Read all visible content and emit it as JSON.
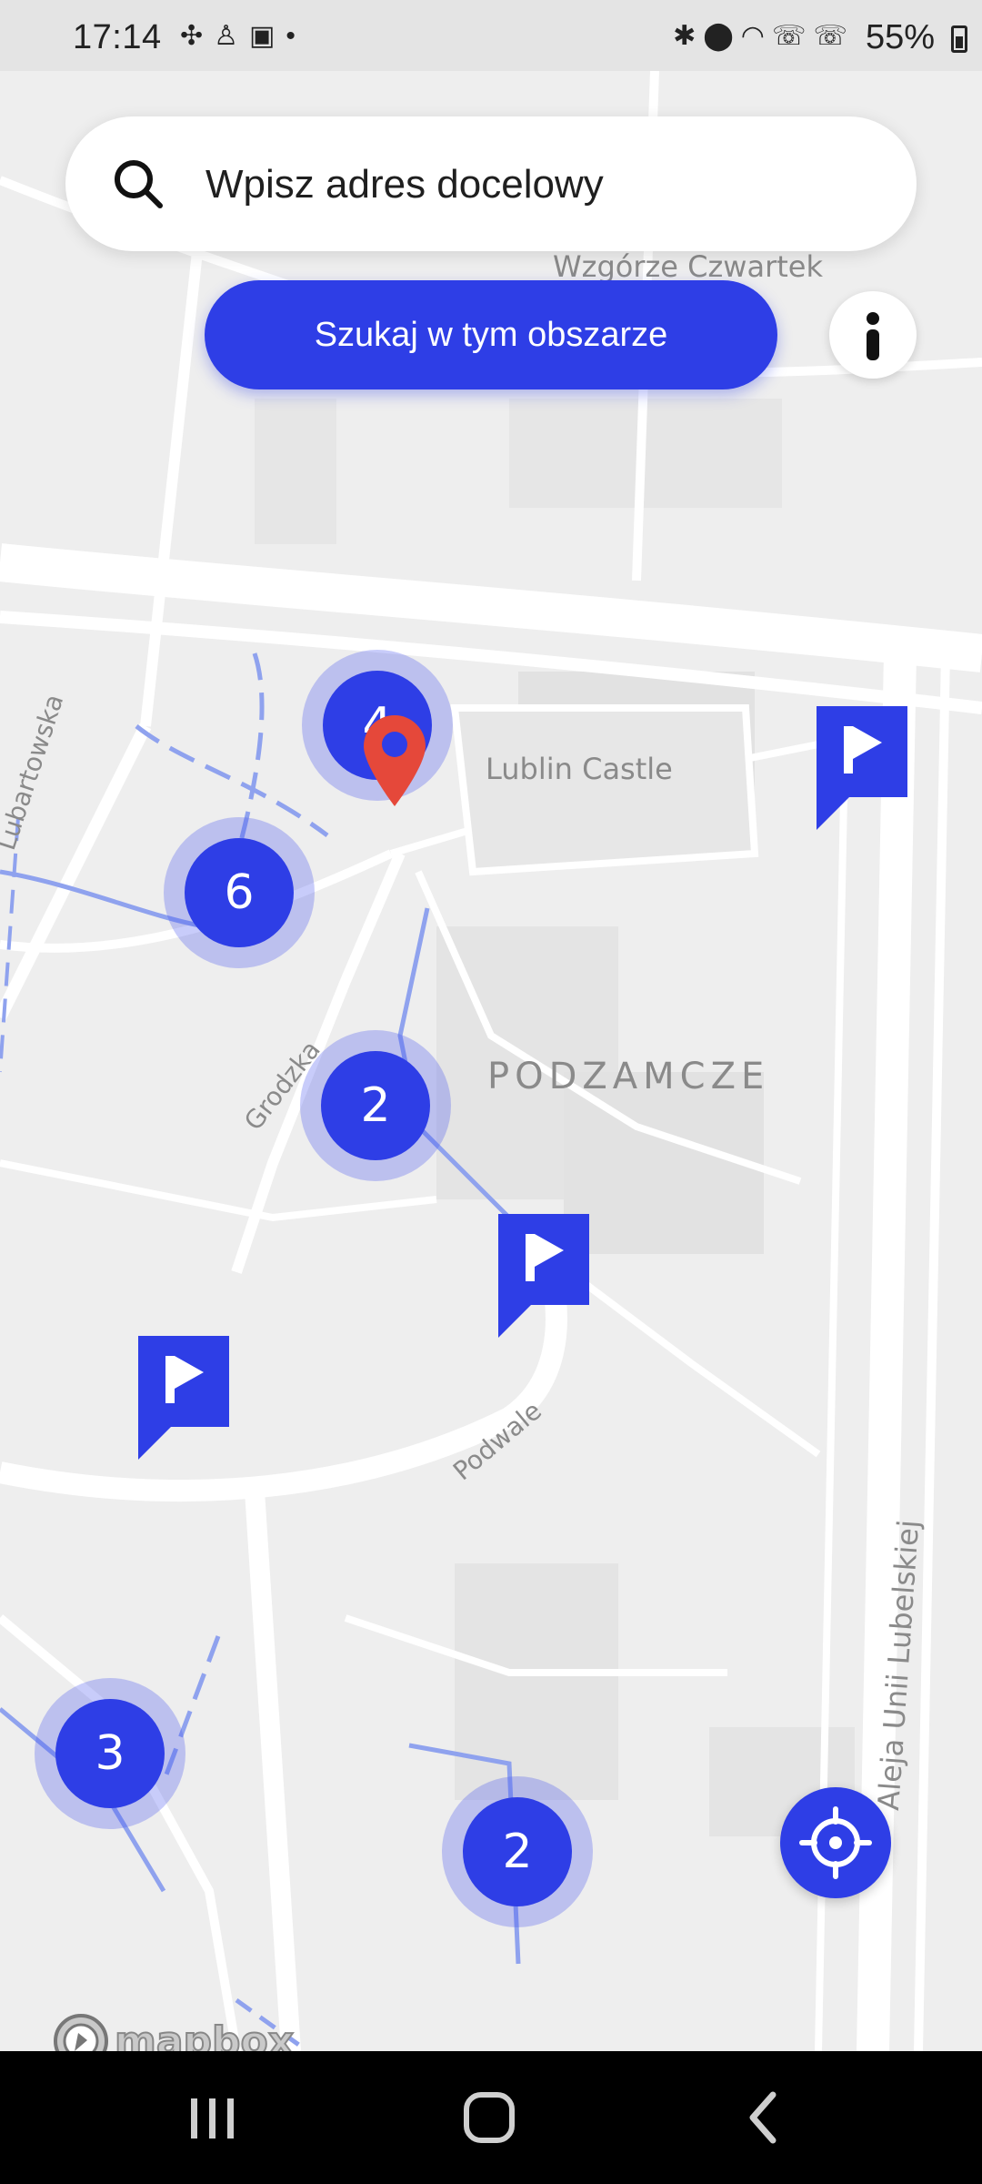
{
  "status_bar": {
    "time": "17:14",
    "notification_icons": [
      "slack-icon",
      "person-icon",
      "video-icon",
      "dot-icon"
    ],
    "system_icons": [
      "bluetooth-icon",
      "location-icon",
      "wifi-icon",
      "call-sim1-icon",
      "call-sim2-icon"
    ],
    "battery_percent": "55%"
  },
  "search": {
    "placeholder": "Wpisz adres docelowy",
    "value": ""
  },
  "search_area_button": {
    "label": "Szukaj w tym obszarze"
  },
  "info_button": {
    "icon": "info-icon"
  },
  "map": {
    "labels": {
      "wzgorze": "Wzgórze Czwartek",
      "castle": "Lublin Castle",
      "lubartowska": "Lubartowska",
      "grodzka": "Grodzka",
      "podzamcze": "PODZAMCZE",
      "podwale": "Podwale",
      "aleja": "Aleja Unii Lubelskiej"
    },
    "clusters": [
      {
        "count": "4"
      },
      {
        "count": "6"
      },
      {
        "count": "2"
      },
      {
        "count": "3"
      },
      {
        "count": "2"
      }
    ],
    "parking_marker_count": 3,
    "destination_pin": "map-pin-icon",
    "attribution": "mapbox"
  },
  "colors": {
    "accent": "#2e3ee6",
    "cluster_halo": "#4856f0",
    "pin": "#e5483a",
    "map_background": "#eeeeee"
  },
  "nav_bar": {
    "buttons": [
      "recent-apps-icon",
      "home-icon",
      "back-icon"
    ]
  }
}
